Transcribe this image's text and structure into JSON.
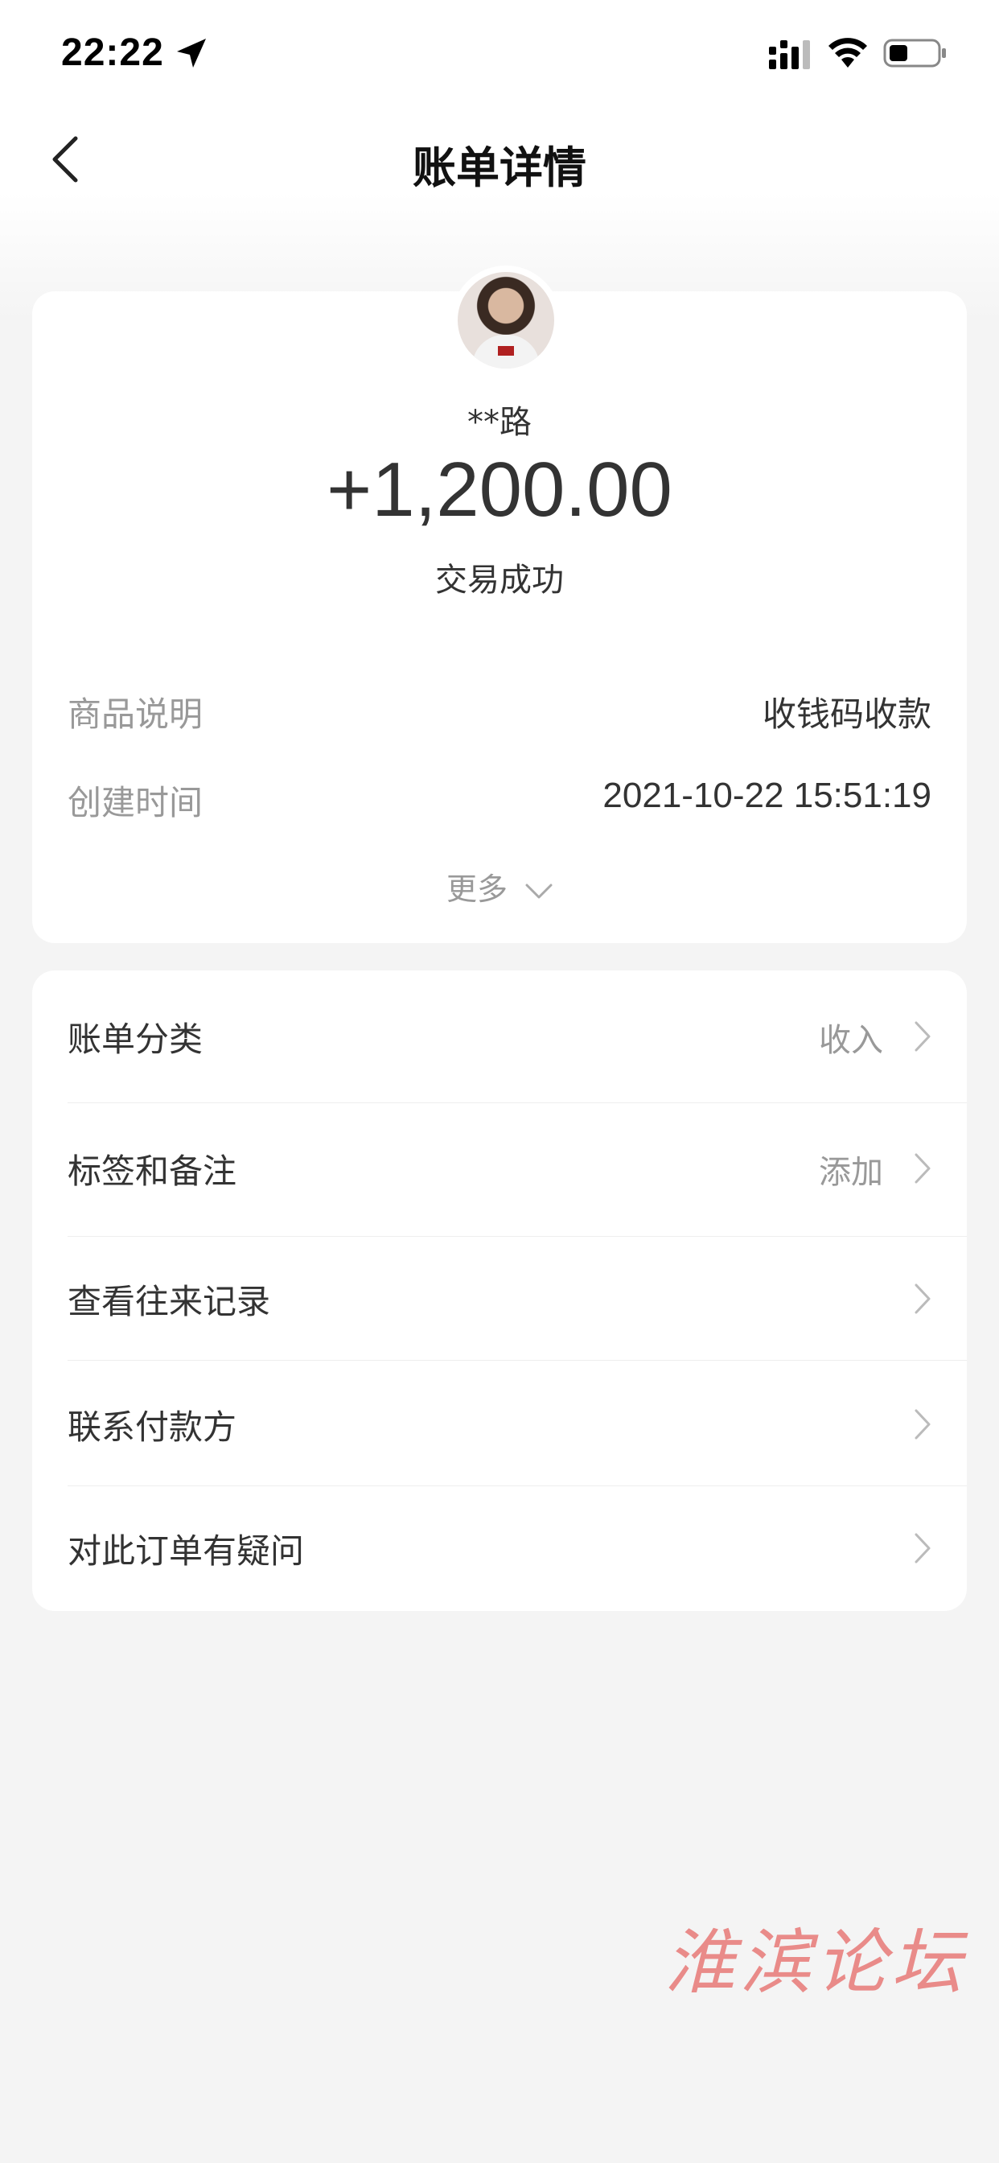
{
  "status_bar": {
    "time": "22:22"
  },
  "nav": {
    "title": "账单详情"
  },
  "summary": {
    "payer_name": "**路",
    "amount": "+1,200.00",
    "status": "交易成功",
    "details": [
      {
        "label": "商品说明",
        "value": "收钱码收款"
      },
      {
        "label": "创建时间",
        "value": "2021-10-22 15:51:19"
      }
    ],
    "more_label": "更多"
  },
  "actions": [
    {
      "label": "账单分类",
      "value": "收入"
    },
    {
      "label": "标签和备注",
      "value": "添加"
    },
    {
      "label": "查看往来记录",
      "value": ""
    },
    {
      "label": "联系付款方",
      "value": ""
    },
    {
      "label": "对此订单有疑问",
      "value": ""
    }
  ],
  "watermark": "淮滨论坛",
  "colors": {
    "background": "#f4f4f4",
    "card": "#ffffff",
    "primary_text": "#333333",
    "secondary_text": "#999999",
    "watermark": "#e8807e"
  }
}
